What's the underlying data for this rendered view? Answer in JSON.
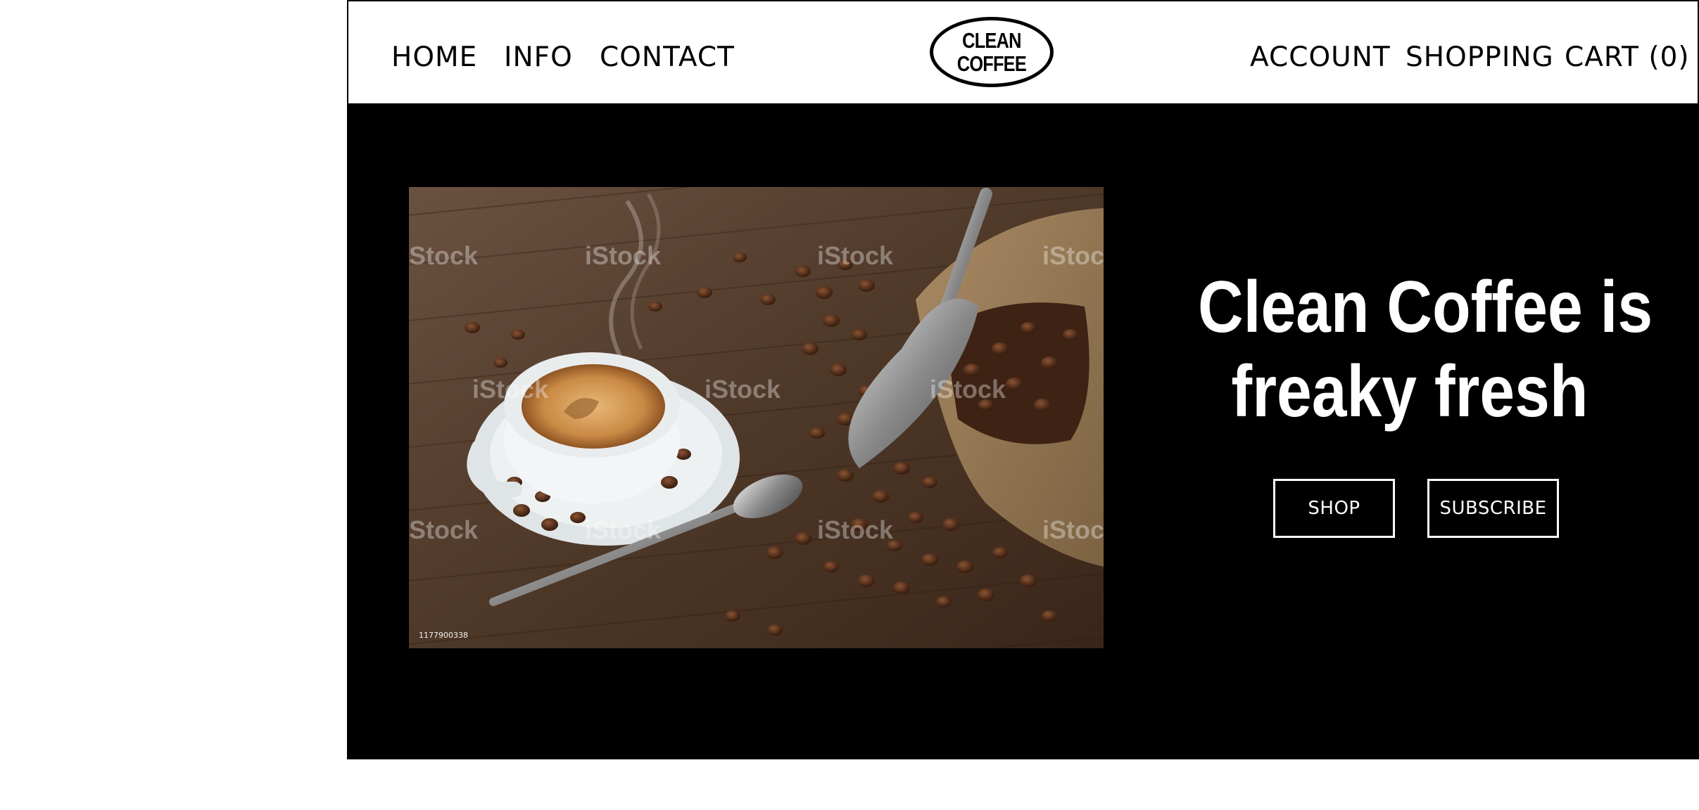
{
  "nav": {
    "left": [
      {
        "label": "HOME"
      },
      {
        "label": "INFO"
      },
      {
        "label": "CONTACT"
      }
    ],
    "right": [
      {
        "label": "ACCOUNT"
      },
      {
        "label": "SHOPPING"
      },
      {
        "label": "CART (0)"
      }
    ]
  },
  "logo": {
    "line1": "CLEAN",
    "line2": "COFFEE"
  },
  "hero": {
    "headline_line1": "Clean Coffee is",
    "headline_line2": "freaky fresh",
    "image_id": "1177900338",
    "watermark": "iStock",
    "buttons": {
      "shop": "SHOP",
      "subscribe": "SUBSCRIBE"
    }
  },
  "colors": {
    "background": "#000000",
    "text": "#ffffff",
    "header_bg": "#ffffff"
  }
}
